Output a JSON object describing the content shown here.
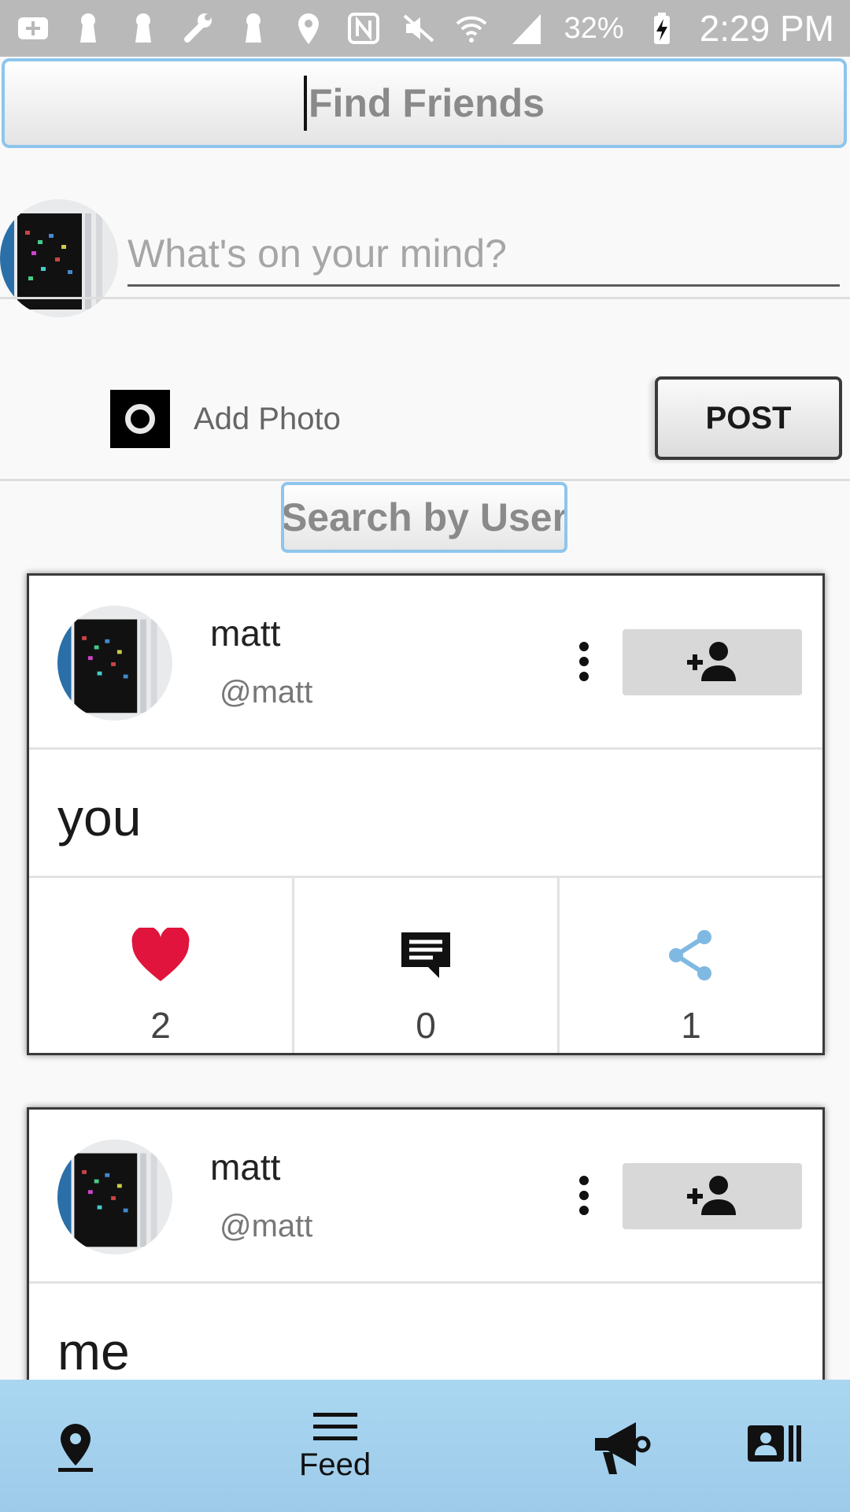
{
  "status_bar": {
    "left_icons": [
      "add-icon",
      "keyhole-icon",
      "keyhole-icon",
      "wrench-icon",
      "keyhole-icon",
      "location-icon",
      "nfc-icon",
      "mute-icon"
    ],
    "right_icons": [
      "wifi-icon",
      "signal-icon"
    ],
    "battery": "32%",
    "time": "2:29 PM"
  },
  "find_friends": {
    "label": "Find Friends"
  },
  "composer": {
    "placeholder": "What's on your mind?",
    "add_photo_label": "Add Photo",
    "post_label": "POST"
  },
  "search_user": {
    "label": "Search by User"
  },
  "posts": [
    {
      "name": "matt",
      "handle": "@matt",
      "text": "you",
      "likes": "2",
      "comments": "0",
      "shares": "1"
    },
    {
      "name": "matt",
      "handle": "@matt",
      "text": "me"
    }
  ],
  "colors": {
    "accent_border": "#8ec5ec",
    "like": "#e0143c",
    "share": "#7fb9e2",
    "nav_background": "#a9d6f0"
  },
  "nav": {
    "items": [
      {
        "icon": "map-pin-icon",
        "label": ""
      },
      {
        "icon": "feed-icon",
        "label": "Feed"
      },
      {
        "icon": "megaphone-icon",
        "label": ""
      },
      {
        "icon": "contacts-icon",
        "label": ""
      }
    ]
  }
}
